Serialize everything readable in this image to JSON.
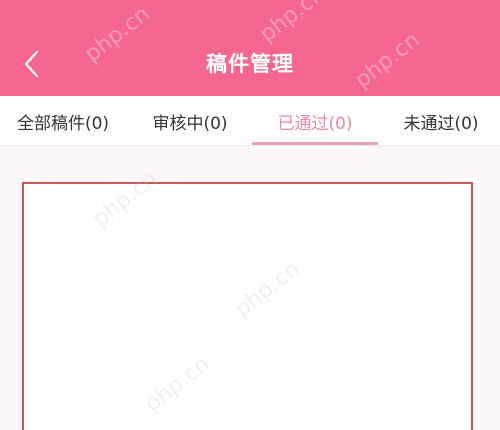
{
  "header": {
    "title": "稿件管理",
    "back_icon": "chevron-left-icon"
  },
  "tabs": [
    {
      "label": "全部稿件(0)",
      "active": false
    },
    {
      "label": "审核中(0)",
      "active": false
    },
    {
      "label": "已通过(0)",
      "active": true
    },
    {
      "label": "未通过(0)",
      "active": false
    }
  ],
  "watermark": "php.cn",
  "colors": {
    "header_bg": "#f5678f",
    "active_tab": "#e88aa1",
    "indicator": "#e6a4b6",
    "highlight_border": "#c1585c"
  }
}
